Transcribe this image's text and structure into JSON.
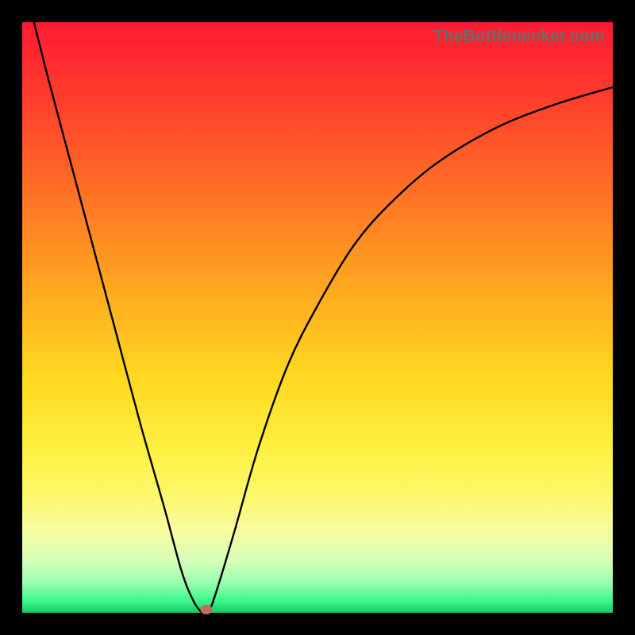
{
  "attribution": "TheBottlenecker.com",
  "chart_data": {
    "type": "line",
    "title": "",
    "xlabel": "",
    "ylabel": "",
    "xlim": [
      0,
      100
    ],
    "ylim": [
      0,
      100
    ],
    "gradient": [
      "#ff1a33",
      "#ffd820",
      "#18c768"
    ],
    "series": [
      {
        "name": "bottleneck-curve",
        "x": [
          0,
          4,
          8,
          12,
          16,
          20,
          24,
          27,
          29,
          30.5,
          31.5,
          33,
          36,
          40,
          45,
          50,
          56,
          62,
          70,
          80,
          90,
          100
        ],
        "y": [
          108,
          92,
          77,
          62,
          47,
          32,
          18,
          7,
          2,
          0,
          0,
          4,
          14,
          28,
          42,
          52,
          62,
          69,
          76,
          82,
          86,
          89
        ]
      }
    ],
    "marker": {
      "x": 31.2,
      "y": 0.5,
      "color": "#c36a60"
    }
  }
}
